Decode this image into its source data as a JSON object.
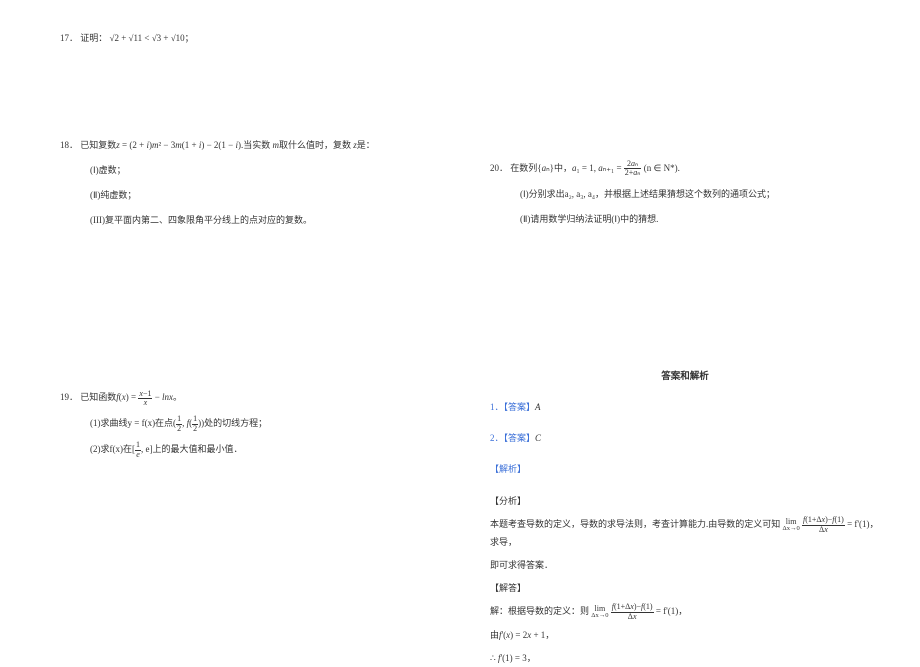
{
  "q17": {
    "num": "17．",
    "text": "证明："
  },
  "q18": {
    "num": "18．",
    "text": "已知复数z = (2 + i)m² − 3m(1 + i) − 2(1 − i).当实数 m取什么值时，复数 z是：",
    "sub1": "(Ⅰ)虚数；",
    "sub2": "(Ⅱ)纯虚数；",
    "sub3": "(III)复平面内第二、四象限角平分线上的点对应的复数。"
  },
  "q19": {
    "num": "19．",
    "text_prefix": "已知函数",
    "sub1_prefix": "(1)求曲线y = f(x)在点(",
    "sub1_suffix": "))处的切线方程；",
    "sub2_prefix": "(2)求f(x)在[",
    "sub2_suffix": ", e]上的最大值和最小值．"
  },
  "q20": {
    "num": "20．",
    "text_prefix": "在数列{aₙ}中，a₁ = 1, aₙ₊₁ = ",
    "text_suffix": "(n ∈ N*).",
    "sub1": "(Ⅰ)分别求出a₂, a₃, a₄，并根据上述结果猜想这个数列的通项公式；",
    "sub2": "(Ⅱ)请用数学归纳法证明(Ⅰ)中的猜想."
  },
  "answers": {
    "header": "答案和解析",
    "a1_label": "1．【答案】",
    "a1_val": "A",
    "a2_label": "2．【答案】",
    "a2_val": "C",
    "analysis_label": "【解析】",
    "fx_label": "【分析】",
    "line1_prefix": "本题考查导数的定义，导数的求导法则，考查计算能力.由导数的定义可知",
    "line1_suffix": " = f'(1)，求导，",
    "line2": "即可求得答案．",
    "jd_label": "【解答】",
    "line3_prefix": "解：根据导数的定义：则",
    "line3_suffix": " = f'(1)，",
    "line4": "由f'(x) = 2x + 1，",
    "line5": "∴ f'(1) = 3，"
  }
}
